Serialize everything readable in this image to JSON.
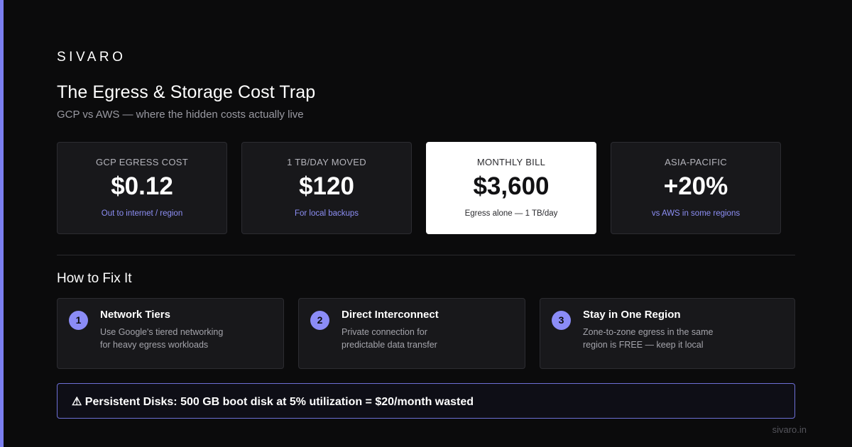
{
  "brand": "SIVARO",
  "title": "The Egress & Storage Cost Trap",
  "subtitle": "GCP vs AWS — where the hidden costs actually live",
  "colors": {
    "background": "#0b0b0c",
    "accent": "#8b8cf7",
    "card": "#18181b",
    "highlight_card": "#ffffff"
  },
  "stats": [
    {
      "label": "GCP EGRESS COST",
      "value": "$0.12",
      "note": "Out to internet / region",
      "highlighted": false
    },
    {
      "label": "1 TB/DAY MOVED",
      "value": "$120",
      "note": "For local backups",
      "highlighted": false
    },
    {
      "label": "MONTHLY BILL",
      "value": "$3,600",
      "note": "Egress alone — 1 TB/day",
      "highlighted": true
    },
    {
      "label": "ASIA-PACIFIC",
      "value": "+20%",
      "note": "vs AWS in some regions",
      "highlighted": false
    }
  ],
  "fix_section_title": "How to Fix It",
  "fixes": [
    {
      "number": "1",
      "title": "Network Tiers",
      "line1": "Use Google's tiered networking",
      "line2": "for heavy egress workloads"
    },
    {
      "number": "2",
      "title": "Direct Interconnect",
      "line1": "Private connection for",
      "line2": "predictable data transfer"
    },
    {
      "number": "3",
      "title": "Stay in One Region",
      "line1": "Zone-to-zone egress in the same",
      "line2": "region is FREE — keep it local"
    }
  ],
  "callout": {
    "icon": "warning-icon",
    "text": "⚠ Persistent Disks: 500 GB boot disk at 5% utilization = $20/month wasted"
  },
  "footer_url": "sivaro.in"
}
